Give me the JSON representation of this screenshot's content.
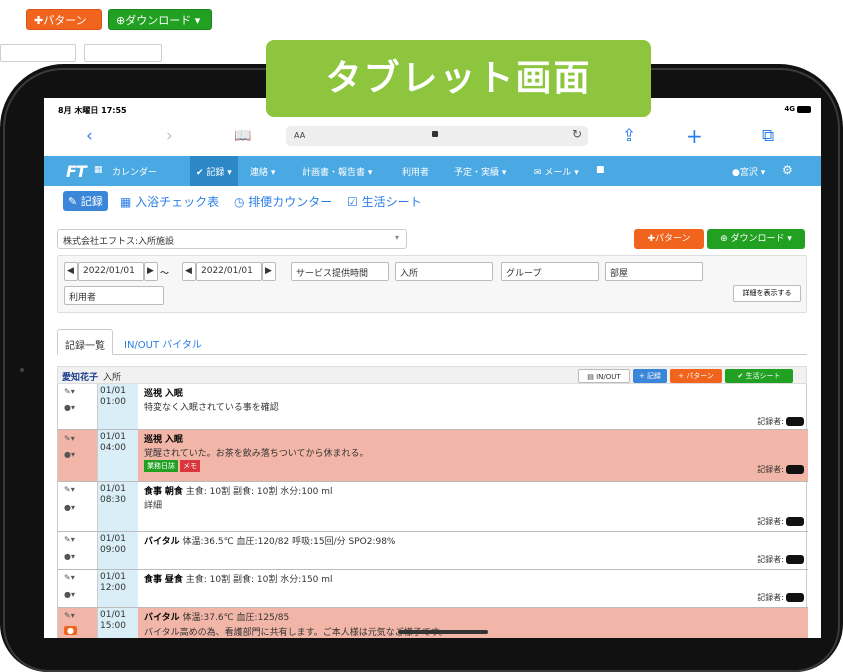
{
  "top_buttons": {
    "pattern": "✚パターン",
    "download": "⊕ダウンロード ▾"
  },
  "banner": "タブレット画面",
  "status_bar": {
    "time": "8月 木曜日 17:55",
    "network": "4G"
  },
  "browser": {
    "back_icon": "‹",
    "forward_icon": "›",
    "book_icon": "📖",
    "url_aa": "AA",
    "reload_icon": "↻",
    "share_icon": "⇪",
    "plus_icon": "+",
    "tabs_icon": "⧉"
  },
  "menubar": {
    "logo": "FT",
    "items": [
      {
        "label": "カレンダー"
      },
      {
        "label": "✔ 記録 ▾"
      },
      {
        "label": "連絡 ▾"
      },
      {
        "label": "計画書・報告書 ▾"
      },
      {
        "label": "利用者"
      },
      {
        "label": "予定・実績 ▾"
      },
      {
        "label": "✉ メール ▾"
      },
      {
        "label": "■"
      }
    ],
    "user": "●宮沢 ▾",
    "settings": "⚙"
  },
  "subnav": {
    "record_btn": "✎ 記録",
    "links": [
      "入浴チェック表",
      "排便カウンター",
      "生活シート"
    ]
  },
  "facility_select": "株式会社エフトス:入所施設",
  "actions": {
    "pattern": "✚パターン",
    "download": "⊕ ダウンロード ▾"
  },
  "filters": {
    "date_from": "2022/01/01",
    "date_to": "2022/01/01",
    "tilde": "～",
    "prev": "◀",
    "next": "▶",
    "service_time": "サービス提供時間",
    "stay": "入所",
    "group": "グループ",
    "room": "部屋",
    "user": "利用者",
    "detail_button": "詳細を表示する"
  },
  "tabs": [
    "記録一覧",
    "IN/OUT バイタル"
  ],
  "person": {
    "name": "愛知花子",
    "stay": "入所",
    "buttons": [
      "▤ IN/OUT",
      "+ 記録",
      "+ パターン",
      "✔ 生活シート"
    ]
  },
  "records": [
    {
      "date": "01/01",
      "time": "01:00",
      "category": "巡視",
      "sub": "入眠",
      "detail": "",
      "body": "特変なく入眠されている事を確認",
      "recorder": "記録者:",
      "highlight": false,
      "tags": []
    },
    {
      "date": "01/01",
      "time": "04:00",
      "category": "巡視",
      "sub": "入眠",
      "detail": "",
      "body": "覚醒されていた。お茶を飲み落ちついてから休まれる。",
      "recorder": "記録者:",
      "highlight": true,
      "tags": [
        "業務日誌",
        "メモ"
      ]
    },
    {
      "date": "01/01",
      "time": "08:30",
      "category": "食事",
      "sub": "朝食",
      "detail": "主食: 10割 副食: 10割 水分:100 ml",
      "body": "詳細",
      "recorder": "記録者:",
      "highlight": false,
      "tags": []
    },
    {
      "date": "01/01",
      "time": "09:00",
      "category": "バイタル",
      "sub": "",
      "detail": "体温:36.5℃ 血圧:120/82 呼吸:15回/分 SPO2:98%",
      "body": "",
      "recorder": "記録者:",
      "highlight": false,
      "tags": []
    },
    {
      "date": "01/01",
      "time": "12:00",
      "category": "食事",
      "sub": "昼食",
      "detail": "主食: 10割 副食: 10割 水分:150 ml",
      "body": "",
      "recorder": "記録者:",
      "highlight": false,
      "tags": []
    },
    {
      "date": "01/01",
      "time": "15:00",
      "category": "バイタル",
      "sub": "",
      "detail": "体温:37.6℃ 血圧:125/85",
      "body": "バイタル高めの為、看護部門に共有します。ご本人様は元気なご様子です。",
      "recorder": "",
      "highlight": true,
      "tags": []
    }
  ]
}
